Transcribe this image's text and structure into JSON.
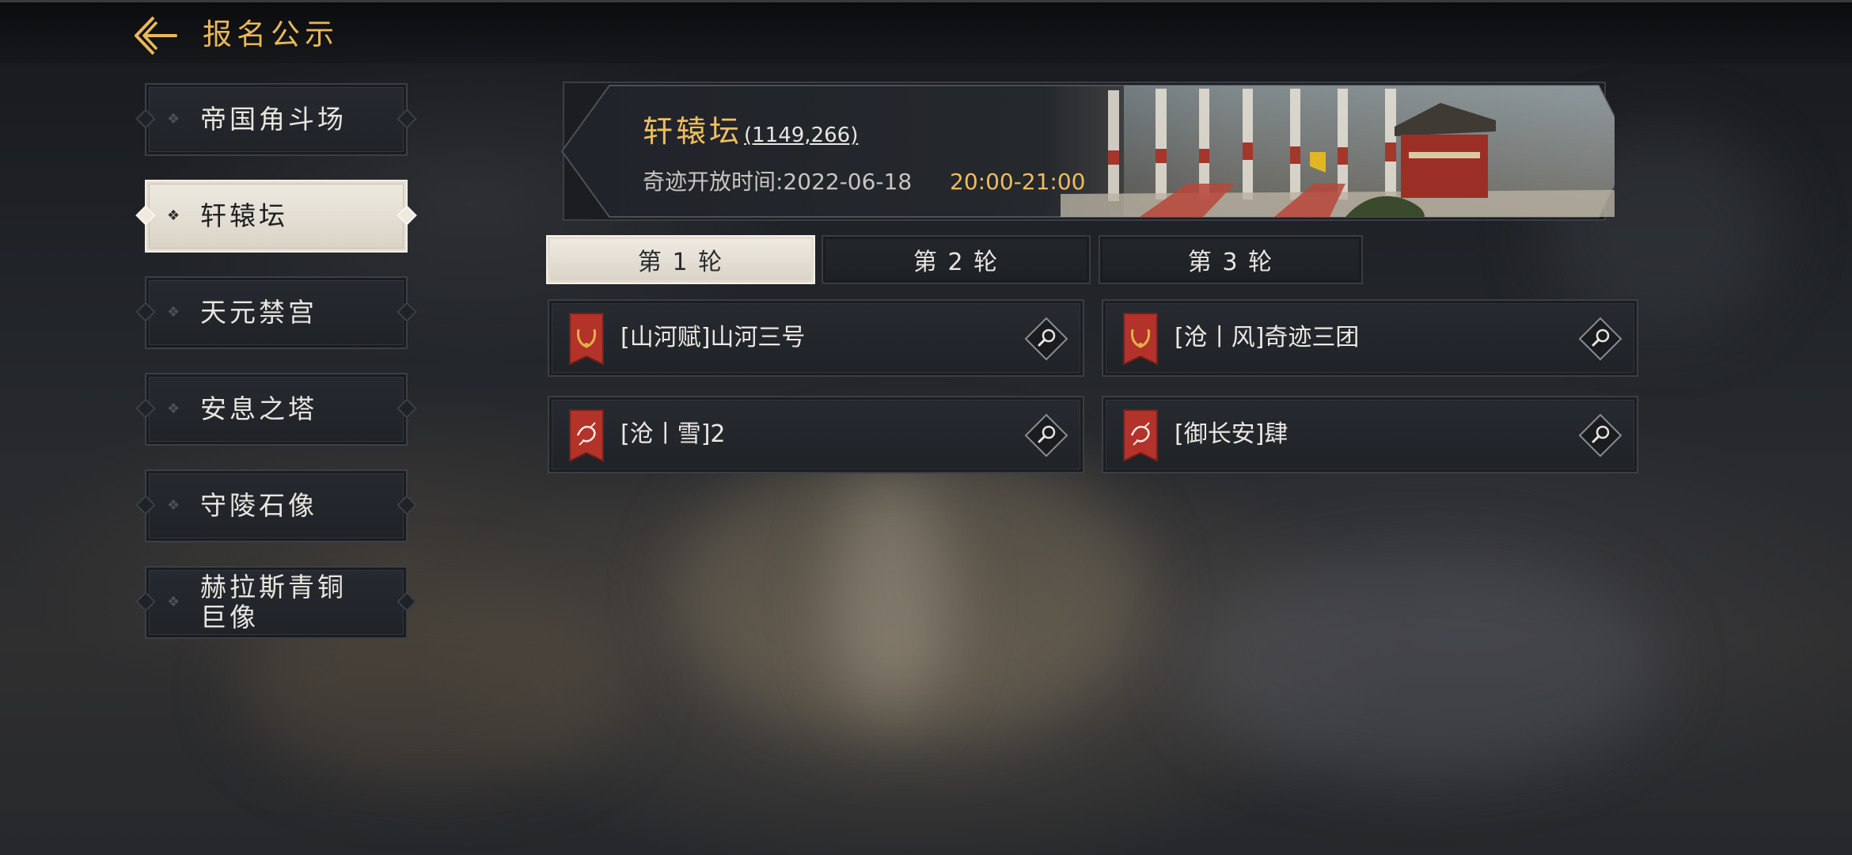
{
  "header": {
    "title": "报名公示"
  },
  "sidebar": {
    "items": [
      {
        "label": "帝国角斗场",
        "active": false
      },
      {
        "label": "轩辕坛",
        "active": true
      },
      {
        "label": "天元禁宫",
        "active": false
      },
      {
        "label": "安息之塔",
        "active": false
      },
      {
        "label": "守陵石像",
        "active": false
      },
      {
        "label": "赫拉斯青铜\n巨像",
        "active": false
      }
    ]
  },
  "banner": {
    "title": "轩辕坛",
    "coords": "(1149,266)",
    "time_label": "奇迹开放时间:2022-06-18",
    "time_value": "20:00-21:00"
  },
  "tabs": [
    {
      "label": "第 1 轮",
      "active": true
    },
    {
      "label": "第 2 轮",
      "active": false
    },
    {
      "label": "第 3 轮",
      "active": false
    }
  ],
  "alliances": [
    {
      "name": "[山河赋]山河三号",
      "flag": "laurel-banner-icon"
    },
    {
      "name": "[沧丨风]奇迹三团",
      "flag": "laurel-banner-icon"
    },
    {
      "name": "[沧丨雪]2",
      "flag": "dragon-banner-icon"
    },
    {
      "name": "[御长安]肆",
      "flag": "dragon-banner-icon"
    }
  ],
  "colors": {
    "accent_gold": "#f0bd5d",
    "flag_red": "#b3322a",
    "panel": "#23262b",
    "active_plate": "#ece7de"
  }
}
